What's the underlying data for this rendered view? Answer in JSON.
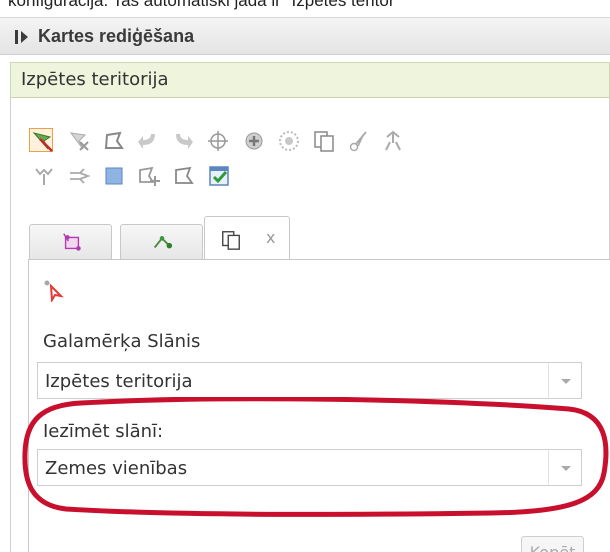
{
  "document": {
    "text_line": "konfigurācijā. Tas automātiski jādā ir \"Izpētes teritor"
  },
  "panel": {
    "title": "Kartes rediģēšana",
    "section_title": "Izpētes teritorija"
  },
  "toolbar": {
    "icons": [
      "select-features-icon",
      "delete-features-icon",
      "edit-vertices-icon",
      "undo-icon",
      "redo-icon",
      "move-icon",
      "add-point-icon",
      "buffer-icon",
      "copy-features-icon",
      "cut-icon",
      "merge-icon",
      "split-icon",
      "reshape-icon",
      "fill-icon",
      "add-part-icon",
      "trace-icon",
      "save-check-icon"
    ]
  },
  "tabs": [
    {
      "icon": "select-layer-icon"
    },
    {
      "icon": "snapping-icon"
    },
    {
      "icon": "copy-tab-icon",
      "close_label": "x",
      "active": true
    }
  ],
  "form": {
    "target_layer_label": "Galamērķa Slānis",
    "target_layer_value": "Izpētes teritorija",
    "select_layer_label": "Iezīmēt slānī:",
    "select_layer_value": "Zemes vienības",
    "copy_button_label": "Kopēt"
  },
  "colors": {
    "section_header_bg": "#eef5dc",
    "highlight_ring": "#c8102e"
  }
}
